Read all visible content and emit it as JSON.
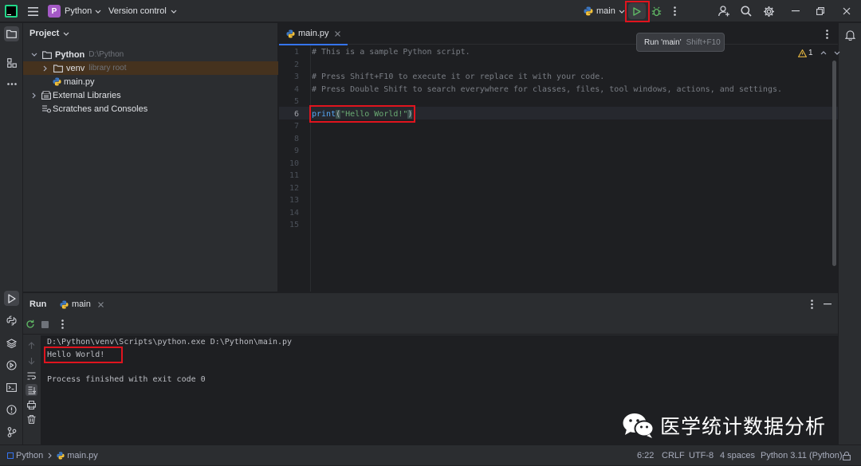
{
  "titlebar": {
    "project_initial": "P",
    "project_name": "Python",
    "vcs": "Version control",
    "run_config": "main",
    "tooltip_label": "Run 'main'",
    "tooltip_shortcut": "Shift+F10"
  },
  "project_panel": {
    "title": "Project",
    "root": {
      "label": "Python",
      "path": "D:\\Python"
    },
    "venv": {
      "label": "venv",
      "suffix": "library root"
    },
    "main_file": "main.py",
    "external": "External Libraries",
    "scratches": "Scratches and Consoles"
  },
  "editor": {
    "tab": "main.py",
    "warnings": "1",
    "line_numbers": [
      "1",
      "2",
      "3",
      "4",
      "5",
      "6",
      "7",
      "8",
      "9",
      "10",
      "11",
      "12",
      "13",
      "14",
      "15"
    ],
    "lines": {
      "l1": "# This is a sample Python script.",
      "l3": "# Press Shift+F10 to execute it or replace it with your code.",
      "l4": "# Press Double Shift to search everywhere for classes, files, tool windows, actions, and settings.",
      "l6_func": "print",
      "l6_open": "(",
      "l6_str": "\"Hello World!\"",
      "l6_close": ")"
    }
  },
  "run_panel": {
    "title": "Run",
    "tab": "main",
    "output": [
      "D:\\Python\\venv\\Scripts\\python.exe D:\\Python\\main.py",
      "Hello World!",
      "",
      "Process finished with exit code 0"
    ]
  },
  "watermark": "医学统计数据分析",
  "status": {
    "crumb_project": "Python",
    "crumb_file": "main.py",
    "position": "6:22",
    "line_sep": "CRLF",
    "encoding": "UTF-8",
    "indent": "4 spaces",
    "interpreter": "Python 3.11 (Python)"
  },
  "colors": {
    "accent": "#e0141e",
    "run_green": "#5fb865",
    "python_yellow": "#f3c13a",
    "python_blue": "#3c78c4",
    "string_green": "#6aab73",
    "keyword_blue": "#56a8f5"
  }
}
